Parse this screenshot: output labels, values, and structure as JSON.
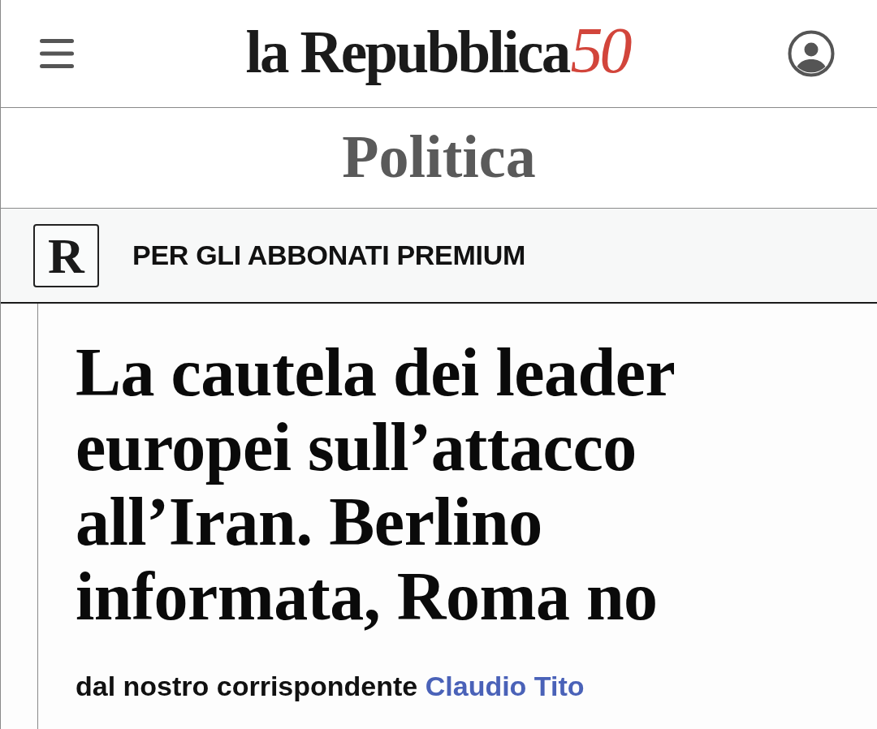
{
  "header": {
    "logo": {
      "wordmark": "la Repubblica",
      "anniversary": "50"
    }
  },
  "section": {
    "title": "Politica"
  },
  "premium_banner": {
    "badge": "R",
    "label": "PER GLI ABBONATI PREMIUM"
  },
  "article": {
    "headline": "La cautela dei leader europei sull’attacco all’Iran. Berlino informata, Roma no",
    "byline": {
      "prefix": "dal nostro corrispondente",
      "author": "Claudio Tito"
    }
  }
}
